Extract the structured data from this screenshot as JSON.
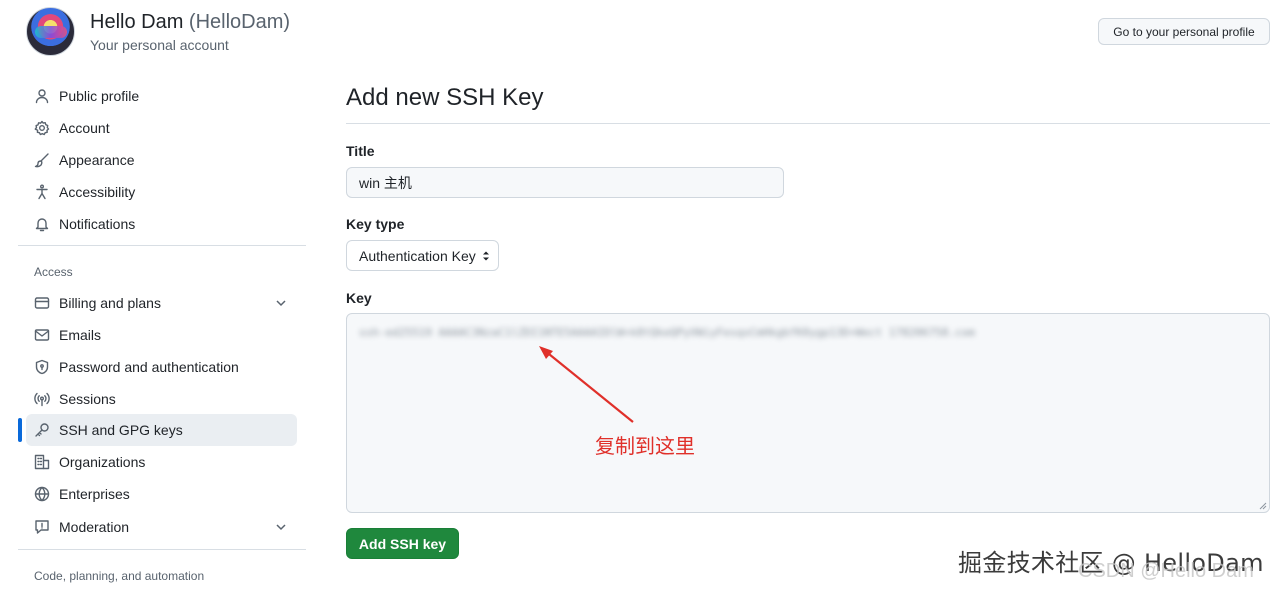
{
  "header": {
    "display_name": "Hello Dam",
    "handle": "(HelloDam)",
    "subtitle": "Your personal account",
    "profile_button": "Go to your personal profile"
  },
  "sidebar": {
    "items": [
      {
        "label": "Public profile",
        "icon": "person-icon"
      },
      {
        "label": "Account",
        "icon": "gear-icon"
      },
      {
        "label": "Appearance",
        "icon": "paintbrush-icon"
      },
      {
        "label": "Accessibility",
        "icon": "accessibility-icon"
      },
      {
        "label": "Notifications",
        "icon": "bell-icon"
      }
    ],
    "access_heading": "Access",
    "access_items": [
      {
        "label": "Billing and plans",
        "icon": "credit-card-icon",
        "expandable": true
      },
      {
        "label": "Emails",
        "icon": "mail-icon"
      },
      {
        "label": "Password and authentication",
        "icon": "shield-lock-icon"
      },
      {
        "label": "Sessions",
        "icon": "broadcast-icon"
      },
      {
        "label": "SSH and GPG keys",
        "icon": "key-icon",
        "active": true
      },
      {
        "label": "Organizations",
        "icon": "organization-icon"
      },
      {
        "label": "Enterprises",
        "icon": "globe-icon"
      },
      {
        "label": "Moderation",
        "icon": "report-icon",
        "expandable": true
      }
    ],
    "code_heading": "Code, planning, and automation"
  },
  "main": {
    "title": "Add new SSH Key",
    "title_field": {
      "label": "Title",
      "value": "win 主机"
    },
    "key_type": {
      "label": "Key type",
      "selected": "Authentication Key"
    },
    "key_field": {
      "label": "Key",
      "value": "ssh-ed25519 AAAAC3NzaC1lZDI1NTE5AAAAIDlW+k8tQkeQPyVWiyFesqxCmHkgbfK0ygp13D+Wect 178206758.com"
    },
    "annotation": "复制到这里",
    "submit_button": "Add SSH key"
  },
  "watermark": {
    "primary": "掘金技术社区 @ HelloDam",
    "secondary": "CSDN @Hello Dam"
  },
  "colors": {
    "accent": "#0969da",
    "primary_button": "#1f883d",
    "annotation": "#e0302a"
  }
}
